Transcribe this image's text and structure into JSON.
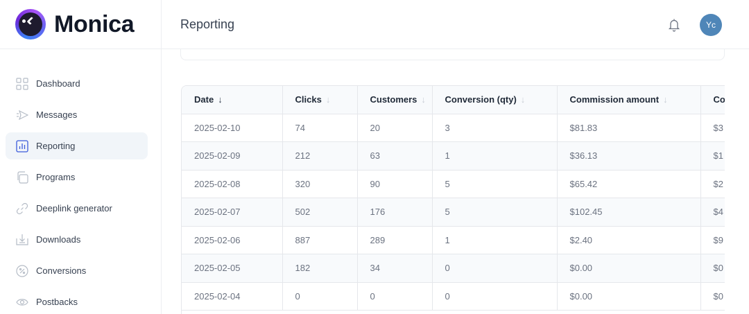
{
  "brand": {
    "name": "Monica"
  },
  "header": {
    "title": "Reporting",
    "avatar_initials": "Yc"
  },
  "sidebar": {
    "items": [
      {
        "label": "Dashboard",
        "icon": "dashboard-icon",
        "active": false
      },
      {
        "label": "Messages",
        "icon": "send-icon",
        "active": false
      },
      {
        "label": "Reporting",
        "icon": "bar-chart-icon",
        "active": true
      },
      {
        "label": "Programs",
        "icon": "copy-icon",
        "active": false
      },
      {
        "label": "Deeplink generator",
        "icon": "link-icon",
        "active": false
      },
      {
        "label": "Downloads",
        "icon": "download-icon",
        "active": false
      },
      {
        "label": "Conversions",
        "icon": "percent-circle-icon",
        "active": false
      },
      {
        "label": "Postbacks",
        "icon": "eye-icon",
        "active": false
      }
    ]
  },
  "table": {
    "columns": [
      {
        "label": "Date",
        "sort": "active-desc"
      },
      {
        "label": "Clicks",
        "sort": "inactive"
      },
      {
        "label": "Customers",
        "sort": "inactive"
      },
      {
        "label": "Conversion (qty)",
        "sort": "inactive"
      },
      {
        "label": "Commission amount",
        "sort": "inactive"
      },
      {
        "label": "Co",
        "sort": "none"
      }
    ],
    "rows": [
      {
        "date": "2025-02-10",
        "clicks": "74",
        "customers": "20",
        "conversion": "3",
        "commission": "$81.83",
        "extra": "$3"
      },
      {
        "date": "2025-02-09",
        "clicks": "212",
        "customers": "63",
        "conversion": "1",
        "commission": "$36.13",
        "extra": "$1"
      },
      {
        "date": "2025-02-08",
        "clicks": "320",
        "customers": "90",
        "conversion": "5",
        "commission": "$65.42",
        "extra": "$2"
      },
      {
        "date": "2025-02-07",
        "clicks": "502",
        "customers": "176",
        "conversion": "5",
        "commission": "$102.45",
        "extra": "$4"
      },
      {
        "date": "2025-02-06",
        "clicks": "887",
        "customers": "289",
        "conversion": "1",
        "commission": "$2.40",
        "extra": "$9"
      },
      {
        "date": "2025-02-05",
        "clicks": "182",
        "customers": "34",
        "conversion": "0",
        "commission": "$0.00",
        "extra": "$0"
      },
      {
        "date": "2025-02-04",
        "clicks": "0",
        "customers": "0",
        "conversion": "0",
        "commission": "$0.00",
        "extra": "$0"
      }
    ]
  },
  "colors": {
    "accent": "#3b5bdb",
    "avatar_bg": "#4f86b8"
  }
}
